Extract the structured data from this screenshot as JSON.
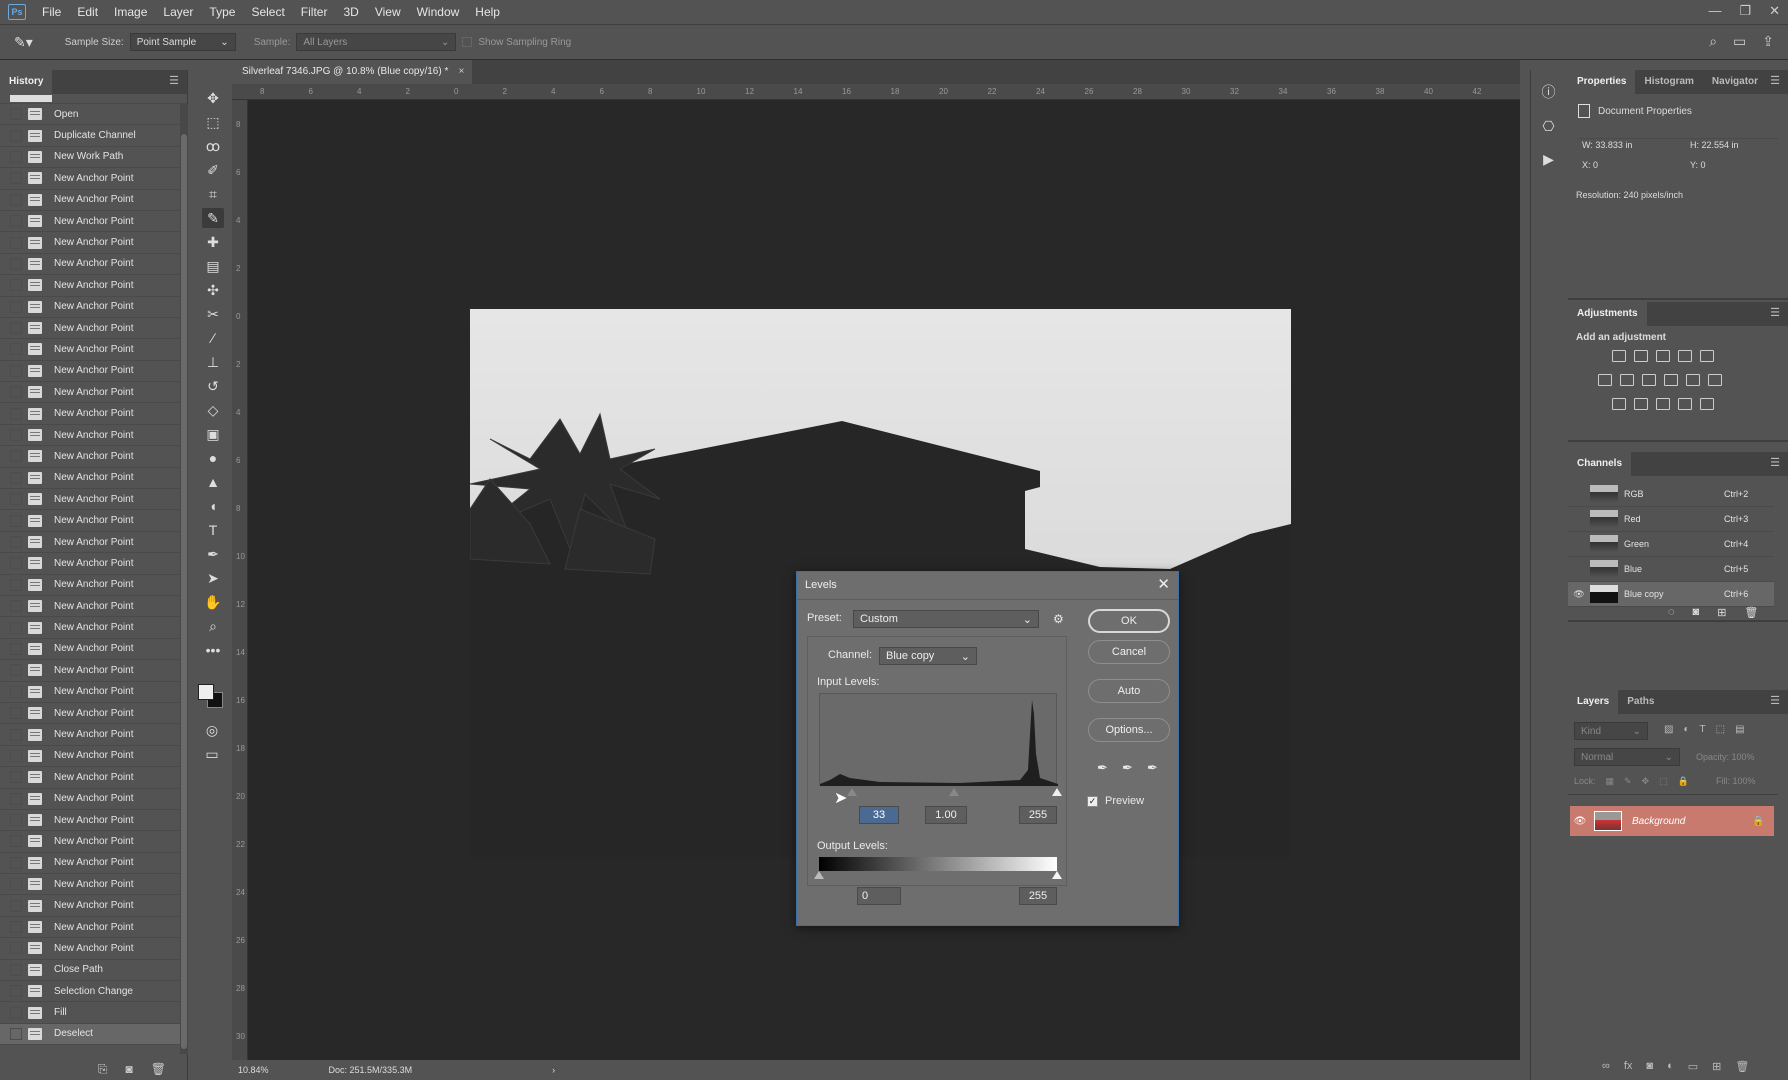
{
  "app": {
    "logo": "Ps"
  },
  "menu": [
    "File",
    "Edit",
    "Image",
    "Layer",
    "Type",
    "Select",
    "Filter",
    "3D",
    "View",
    "Window",
    "Help"
  ],
  "window_controls": [
    "—",
    "❐",
    "✕"
  ],
  "options": {
    "sample_size_label": "Sample Size:",
    "sample_size_value": "Point Sample",
    "sample_label": "Sample:",
    "sample_value": "All Layers",
    "ring_label": "Show Sampling Ring"
  },
  "history": {
    "tab": "History",
    "items": [
      "Open",
      "Duplicate Channel",
      "New Work Path",
      "New Anchor Point",
      "New Anchor Point",
      "New Anchor Point",
      "New Anchor Point",
      "New Anchor Point",
      "New Anchor Point",
      "New Anchor Point",
      "New Anchor Point",
      "New Anchor Point",
      "New Anchor Point",
      "New Anchor Point",
      "New Anchor Point",
      "New Anchor Point",
      "New Anchor Point",
      "New Anchor Point",
      "New Anchor Point",
      "New Anchor Point",
      "New Anchor Point",
      "New Anchor Point",
      "New Anchor Point",
      "New Anchor Point",
      "New Anchor Point",
      "New Anchor Point",
      "New Anchor Point",
      "New Anchor Point",
      "New Anchor Point",
      "New Anchor Point",
      "New Anchor Point",
      "New Anchor Point",
      "New Anchor Point",
      "New Anchor Point",
      "New Anchor Point",
      "New Anchor Point",
      "New Anchor Point",
      "New Anchor Point",
      "New Anchor Point",
      "New Anchor Point",
      "Close Path",
      "Selection Change",
      "Fill",
      "Deselect"
    ],
    "selected_index": 43
  },
  "document": {
    "tab_title": "Silverleaf 7346.JPG @ 10.8% (Blue copy/16) *",
    "zoom": "10.84%",
    "doc_size": "Doc: 251.5M/335.3M",
    "ruler_h": [
      "8",
      "6",
      "4",
      "2",
      "0",
      "2",
      "4",
      "6",
      "8",
      "10",
      "12",
      "14",
      "16",
      "18",
      "20",
      "22",
      "24",
      "26",
      "28",
      "30",
      "32",
      "34",
      "36",
      "38",
      "40",
      "42"
    ],
    "ruler_v": [
      "8",
      "6",
      "4",
      "2",
      "0",
      "2",
      "4",
      "6",
      "8",
      "10",
      "12",
      "14",
      "16",
      "18",
      "20",
      "22",
      "24",
      "26",
      "28",
      "30"
    ]
  },
  "properties": {
    "tabs": [
      "Properties",
      "Histogram",
      "Navigator"
    ],
    "title": "Document Properties",
    "w_label": "W:",
    "w": "33.833 in",
    "h_label": "H:",
    "h": "22.554 in",
    "x_label": "X:",
    "x": "0",
    "y_label": "Y:",
    "y": "0",
    "resolution": "Resolution: 240 pixels/inch"
  },
  "adjustments": {
    "tab": "Adjustments",
    "subtitle": "Add an adjustment"
  },
  "channels": {
    "tab": "Channels",
    "items": [
      {
        "name": "RGB",
        "key": "Ctrl+2",
        "visible": false
      },
      {
        "name": "Red",
        "key": "Ctrl+3",
        "visible": false
      },
      {
        "name": "Green",
        "key": "Ctrl+4",
        "visible": false
      },
      {
        "name": "Blue",
        "key": "Ctrl+5",
        "visible": false
      },
      {
        "name": "Blue copy",
        "key": "Ctrl+6",
        "visible": true
      }
    ]
  },
  "layers": {
    "tabs": [
      "Layers",
      "Paths"
    ],
    "kind": "Kind",
    "blend": "Normal",
    "opacity_label": "Opacity:",
    "opacity": "100%",
    "lock_label": "Lock:",
    "fill_label": "Fill:",
    "fill": "100%",
    "background": "Background"
  },
  "levels": {
    "title": "Levels",
    "preset_label": "Preset:",
    "preset": "Custom",
    "channel_label": "Channel:",
    "channel": "Blue copy",
    "input_label": "Input Levels:",
    "input_black": "33",
    "input_gamma": "1.00",
    "input_white": "255",
    "output_label": "Output Levels:",
    "output_black": "0",
    "output_white": "255",
    "buttons": {
      "ok": "OK",
      "cancel": "Cancel",
      "auto": "Auto",
      "options": "Options..."
    },
    "preview_label": "Preview",
    "preview_checked": true
  },
  "colors": {
    "accent": "#3b6fa8",
    "layer_selected": "#c97a6e"
  }
}
